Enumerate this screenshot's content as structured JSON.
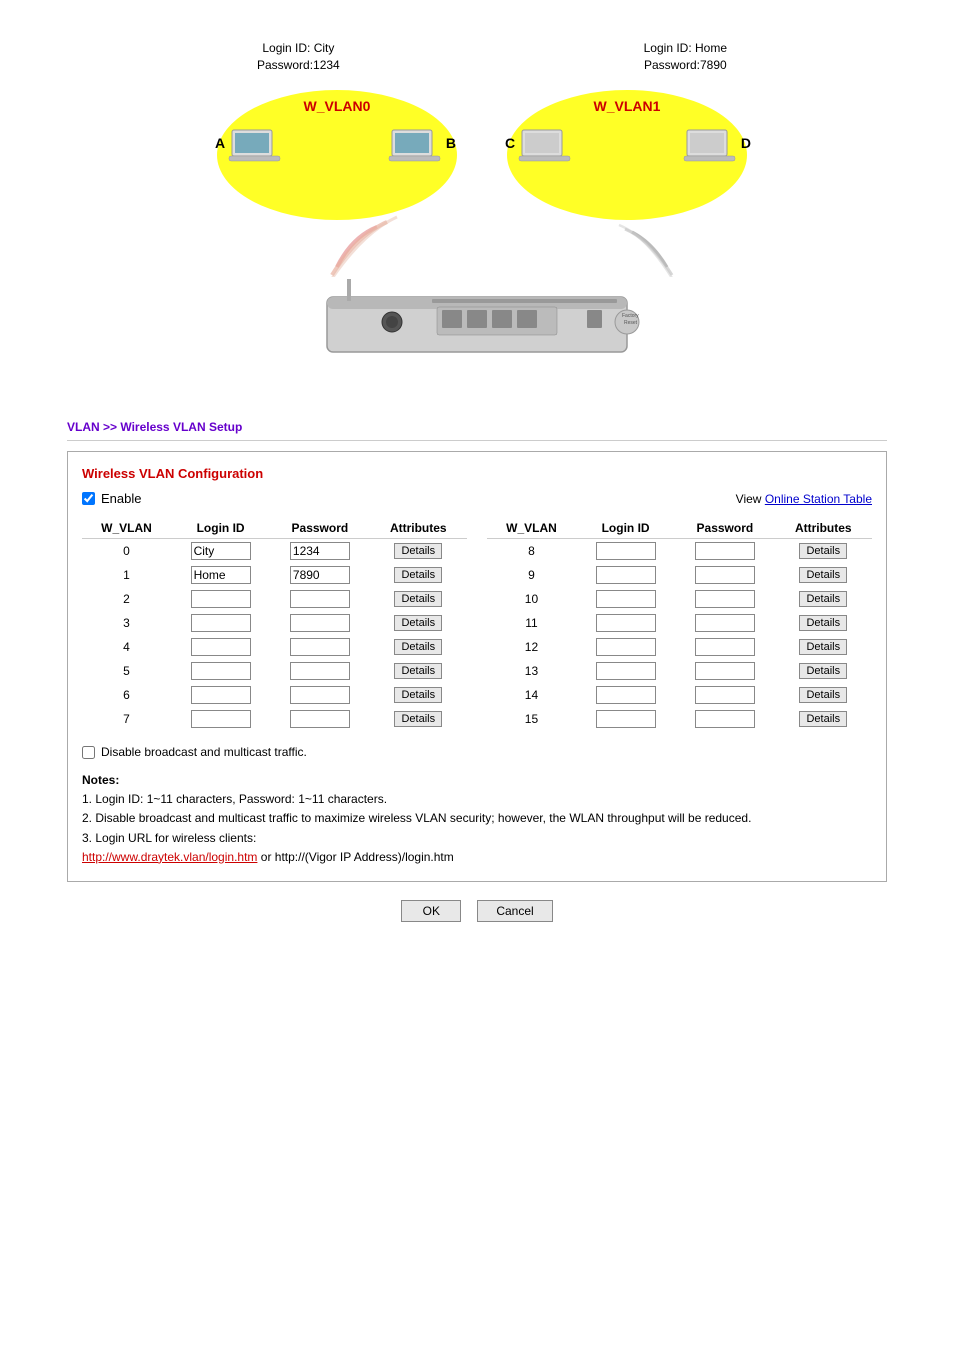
{
  "diagram": {
    "left_login_id": "Login ID: City",
    "left_password": "Password:1234",
    "right_login_id": "Login ID: Home",
    "right_password": "Password:7890",
    "left_vlan_label": "W_VLAN0",
    "right_vlan_label": "W_VLAN1",
    "nodes": [
      "A",
      "B",
      "C",
      "D"
    ]
  },
  "breadcrumb": "VLAN >> Wireless VLAN Setup",
  "config_title": "Wireless VLAN Configuration",
  "enable_label": "Enable",
  "view_label": "View",
  "online_station_table": "Online Station Table",
  "table_headers": {
    "w_vlan": "W_VLAN",
    "login_id": "Login ID",
    "password": "Password",
    "attributes": "Attributes"
  },
  "left_rows": [
    {
      "w_vlan": "0",
      "login_id": "City",
      "password": "1234"
    },
    {
      "w_vlan": "1",
      "login_id": "Home",
      "password": "7890"
    },
    {
      "w_vlan": "2",
      "login_id": "",
      "password": ""
    },
    {
      "w_vlan": "3",
      "login_id": "",
      "password": ""
    },
    {
      "w_vlan": "4",
      "login_id": "",
      "password": ""
    },
    {
      "w_vlan": "5",
      "login_id": "",
      "password": ""
    },
    {
      "w_vlan": "6",
      "login_id": "",
      "password": ""
    },
    {
      "w_vlan": "7",
      "login_id": "",
      "password": ""
    }
  ],
  "right_rows": [
    {
      "w_vlan": "8",
      "login_id": "",
      "password": ""
    },
    {
      "w_vlan": "9",
      "login_id": "",
      "password": ""
    },
    {
      "w_vlan": "10",
      "login_id": "",
      "password": ""
    },
    {
      "w_vlan": "11",
      "login_id": "",
      "password": ""
    },
    {
      "w_vlan": "12",
      "login_id": "",
      "password": ""
    },
    {
      "w_vlan": "13",
      "login_id": "",
      "password": ""
    },
    {
      "w_vlan": "14",
      "login_id": "",
      "password": ""
    },
    {
      "w_vlan": "15",
      "login_id": "",
      "password": ""
    }
  ],
  "details_btn_label": "Details",
  "broadcast_label": "Disable broadcast and multicast traffic.",
  "notes_title": "Notes:",
  "note_1": "1. Login ID: 1~11 characters, Password: 1~11 characters.",
  "note_2": "2. Disable broadcast and multicast traffic to maximize wireless VLAN security; however, the WLAN throughput will be reduced.",
  "note_3": "3. Login URL for wireless clients:",
  "note_url_1": "http://www.draytek.vlan/login.htm",
  "note_url_or": "  or  ",
  "note_url_2": "http://(Vigor IP Address)/login.htm",
  "ok_label": "OK",
  "cancel_label": "Cancel"
}
